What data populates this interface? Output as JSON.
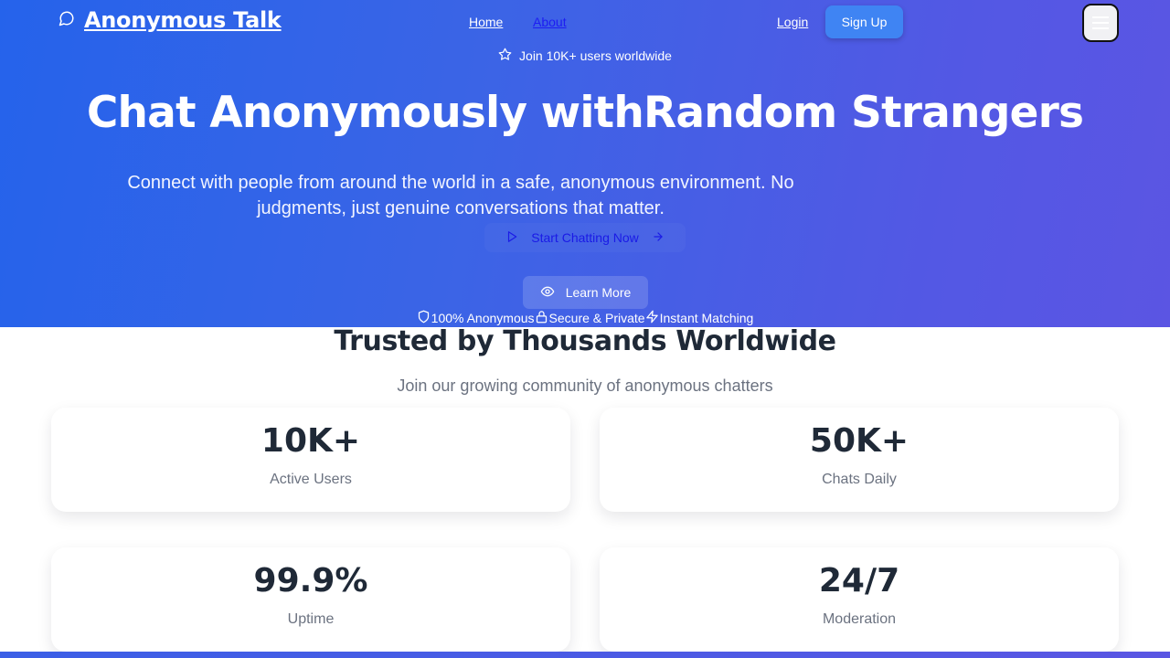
{
  "brand": {
    "name": "Anonymous Talk",
    "icon": "chat-bubble-icon"
  },
  "nav": {
    "home": "Home",
    "about": "About",
    "login": "Login",
    "signup": "Sign Up",
    "menu_icon": "hamburger-menu-icon"
  },
  "hero": {
    "pill": "Join 10K+ users worldwide",
    "headline": "Chat Anonymously withRandom Strangers",
    "subtext": "Connect with people from around the world in a safe, anonymous environment. No judgments, just genuine conversations that matter.",
    "cta": "Start Chatting Now",
    "learn_more": "Learn More",
    "features": [
      {
        "label": "100% Anonymous",
        "icon": "shield-icon"
      },
      {
        "label": "Secure & Private",
        "icon": "lock-icon"
      },
      {
        "label": "Instant Matching",
        "icon": "lightning-icon"
      }
    ]
  },
  "stats": {
    "title": "Trusted by Thousands Worldwide",
    "subtitle": "Join our growing community of anonymous chatters",
    "items": [
      {
        "value": "10K+",
        "label": "Active Users"
      },
      {
        "value": "50K+",
        "label": "Chats Daily"
      },
      {
        "value": "99.9%",
        "label": "Uptime"
      },
      {
        "value": "24/7",
        "label": "Moderation"
      }
    ]
  },
  "colors": {
    "hero_start": "#2563eb",
    "hero_end": "#5b55e3",
    "signup": "#3f84f3",
    "heading": "#1f2937",
    "muted": "#6b7280"
  }
}
